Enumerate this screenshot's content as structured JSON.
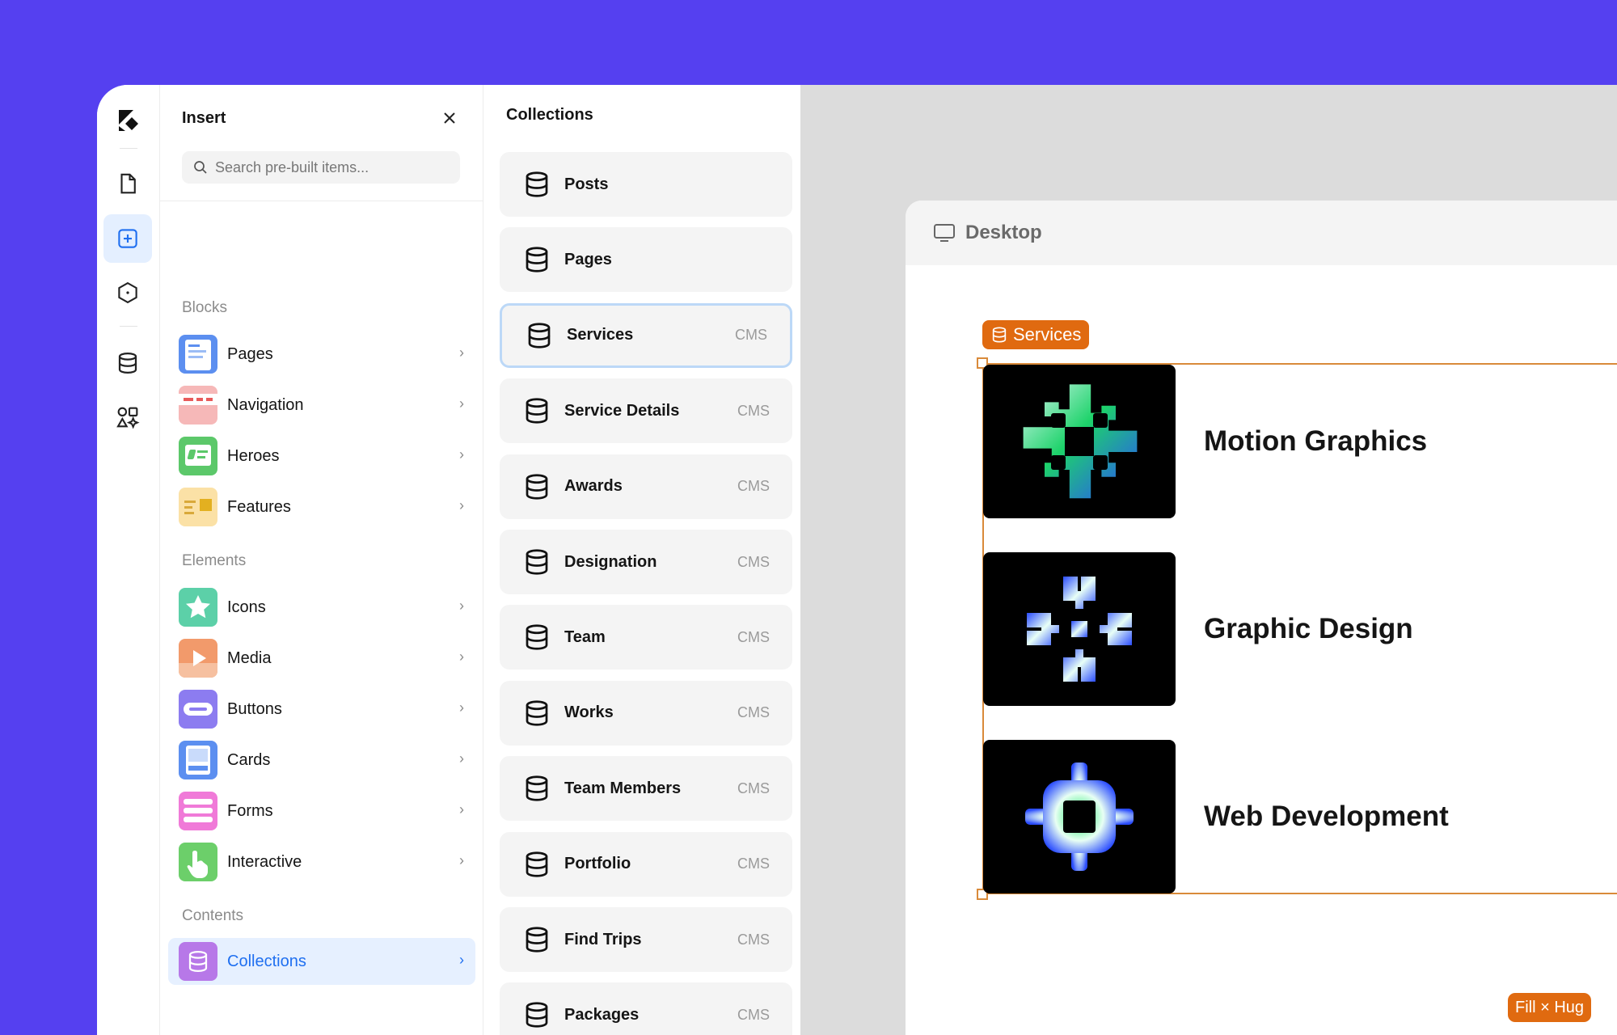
{
  "insert": {
    "title": "Insert",
    "search_placeholder": "Search pre-built items...",
    "sections": {
      "blocks": "Blocks",
      "elements": "Elements",
      "contents": "Contents"
    },
    "blocks": [
      {
        "label": "Pages"
      },
      {
        "label": "Navigation"
      },
      {
        "label": "Heroes"
      },
      {
        "label": "Features"
      }
    ],
    "elements": [
      {
        "label": "Icons"
      },
      {
        "label": "Media"
      },
      {
        "label": "Buttons"
      },
      {
        "label": "Cards"
      },
      {
        "label": "Forms"
      },
      {
        "label": "Interactive"
      }
    ],
    "contents": [
      {
        "label": "Collections",
        "selected": true
      }
    ],
    "chevron": "›"
  },
  "collections": {
    "title": "Collections",
    "items": [
      {
        "name": "Posts",
        "badge": ""
      },
      {
        "name": "Pages",
        "badge": ""
      },
      {
        "name": "Services",
        "badge": "CMS",
        "selected": true
      },
      {
        "name": "Service Details",
        "badge": "CMS"
      },
      {
        "name": "Awards",
        "badge": "CMS"
      },
      {
        "name": "Designation",
        "badge": "CMS"
      },
      {
        "name": "Team",
        "badge": "CMS"
      },
      {
        "name": "Works",
        "badge": "CMS"
      },
      {
        "name": "Team Members",
        "badge": "CMS"
      },
      {
        "name": "Portfolio",
        "badge": "CMS"
      },
      {
        "name": "Find Trips",
        "badge": "CMS"
      },
      {
        "name": "Packages",
        "badge": "CMS"
      }
    ]
  },
  "canvas": {
    "frame_label": "Desktop",
    "selection_tag": "Services",
    "size_tag": "Fill × Hug",
    "services": [
      {
        "title": "Motion Graphics",
        "icon": "plus-grid-icon"
      },
      {
        "title": "Graphic Design",
        "icon": "cross-pattern-icon"
      },
      {
        "title": "Web Development",
        "icon": "gear-square-icon"
      }
    ]
  },
  "colors": {
    "background": "#5540f0",
    "accent_blue": "#1f6ff0",
    "selection_orange": "#e06a10",
    "canvas_bg": "#dcdcdc"
  }
}
